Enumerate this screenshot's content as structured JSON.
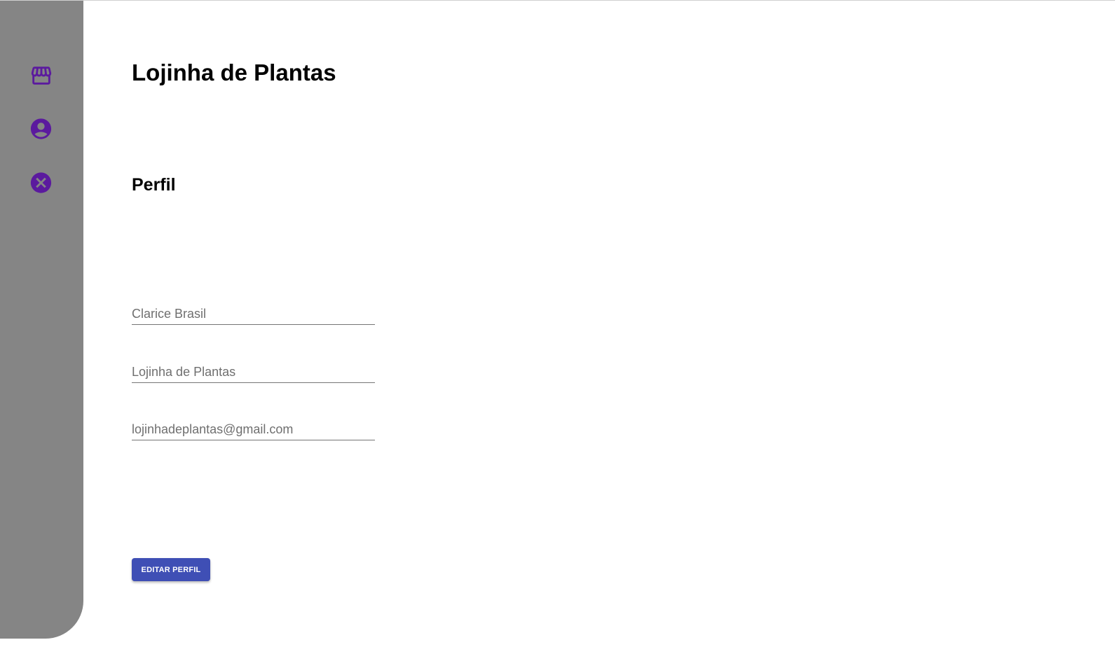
{
  "sidebar": {
    "color": "#858585",
    "icon_color": "#5b1a9e",
    "items": [
      {
        "icon": "store-icon"
      },
      {
        "icon": "account-circle-icon"
      },
      {
        "icon": "cancel-icon"
      }
    ]
  },
  "header": {
    "title": "Lojinha de Plantas"
  },
  "profile": {
    "section_title": "Perfil",
    "fields": {
      "name": "Clarice Brasil",
      "store": "Lojinha de Plantas",
      "email": "lojinhadeplantas@gmail.com"
    },
    "edit_button_label": "EDITAR PERFIL",
    "button_color": "#3f4fb5"
  }
}
